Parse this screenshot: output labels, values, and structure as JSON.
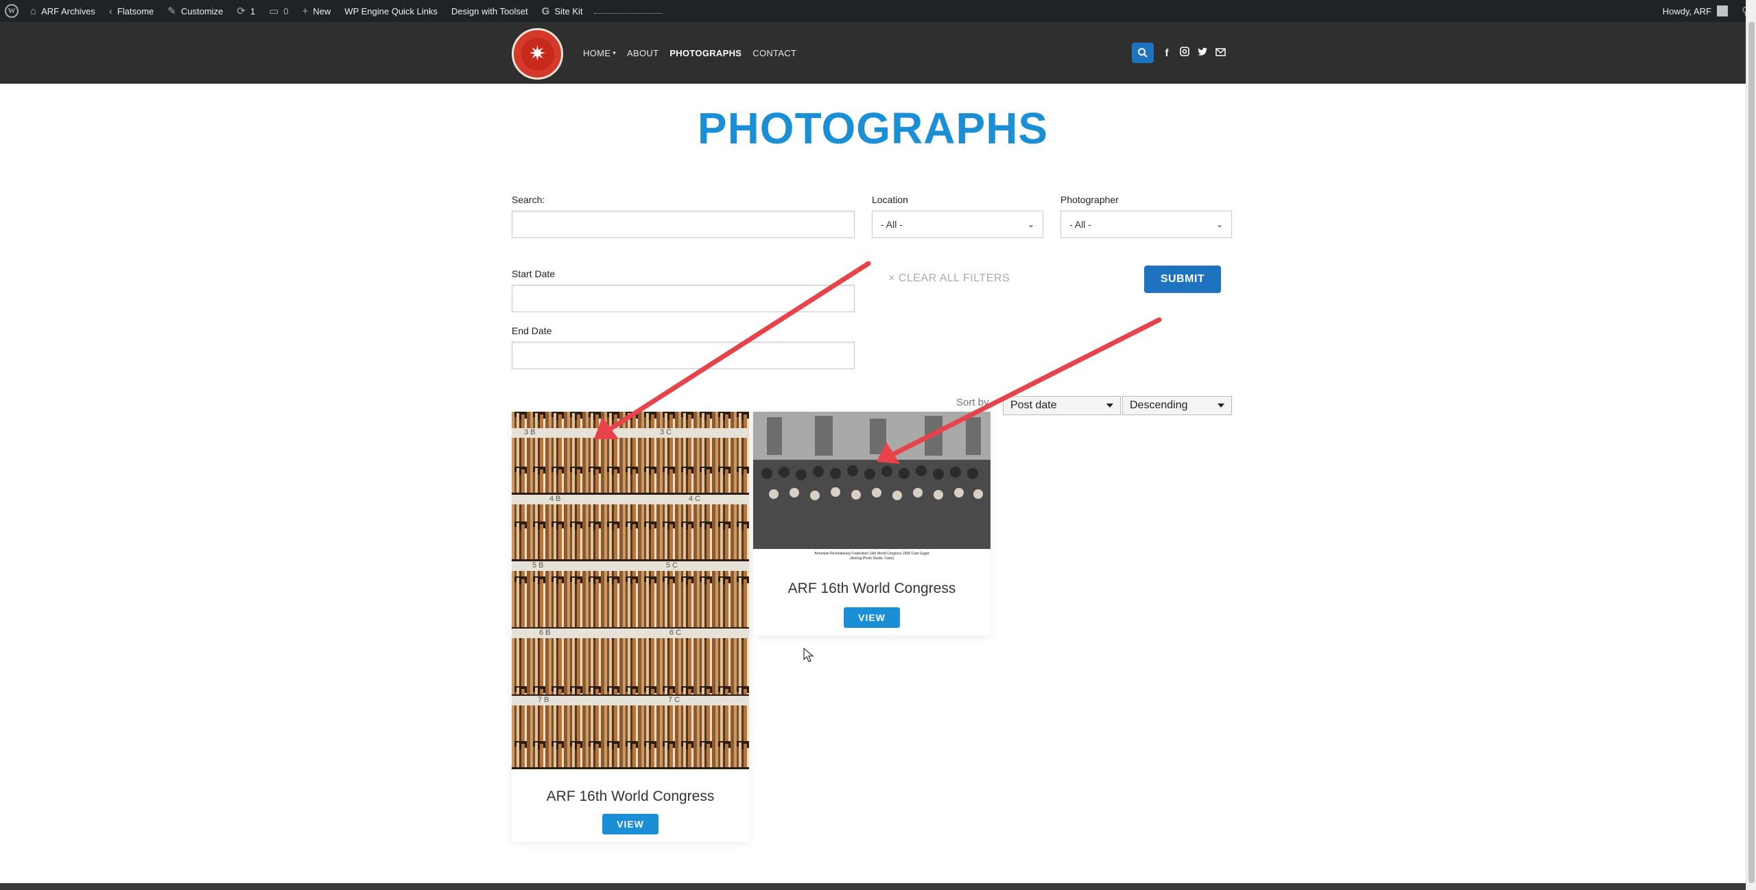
{
  "adminbar": {
    "site": "ARF Archives",
    "theme": "Flatsome",
    "customize": "Customize",
    "updates": "1",
    "comments": "0",
    "new": "New",
    "wpengine": "WP Engine Quick Links",
    "toolset": "Design with Toolset",
    "sitekit": "Site Kit",
    "howdy": "Howdy, ARF"
  },
  "nav": {
    "home": "HOME",
    "about": "ABOUT",
    "photographs": "PHOTOGRAPHS",
    "contact": "CONTACT"
  },
  "page": {
    "title": "PHOTOGRAPHS"
  },
  "filters": {
    "search_label": "Search:",
    "location_label": "Location",
    "location_value": "- All -",
    "photographer_label": "Photographer",
    "photographer_value": "- All -",
    "start_label": "Start Date",
    "end_label": "End Date",
    "clear": "× CLEAR ALL FILTERS",
    "submit": "SUBMIT"
  },
  "sort": {
    "label": "Sort by",
    "field": "Post date",
    "order": "Descending"
  },
  "cards": [
    {
      "title": "ARF 16th World Congress",
      "view": "VIEW",
      "shelf_labels": [
        [
          "3 B",
          "3 C"
        ],
        [
          "4 B",
          "4 C"
        ],
        [
          "5 B",
          "5 C"
        ],
        [
          "6 B",
          "6 C"
        ],
        [
          "7 B",
          "7 C"
        ]
      ]
    },
    {
      "title": "ARF 16th World Congress",
      "view": "VIEW",
      "caption_1": "Armenian Revolutionary Federation 16th World Congress 1958 Cairo Egypt",
      "caption_2": "(Arshag Photo Studio, Cairo)"
    }
  ],
  "colors": {
    "accent": "#1a8fd6",
    "submit": "#1e73be",
    "header": "#2f2f2f",
    "adminbar": "#1d2327",
    "arrow": "#e8434a"
  }
}
